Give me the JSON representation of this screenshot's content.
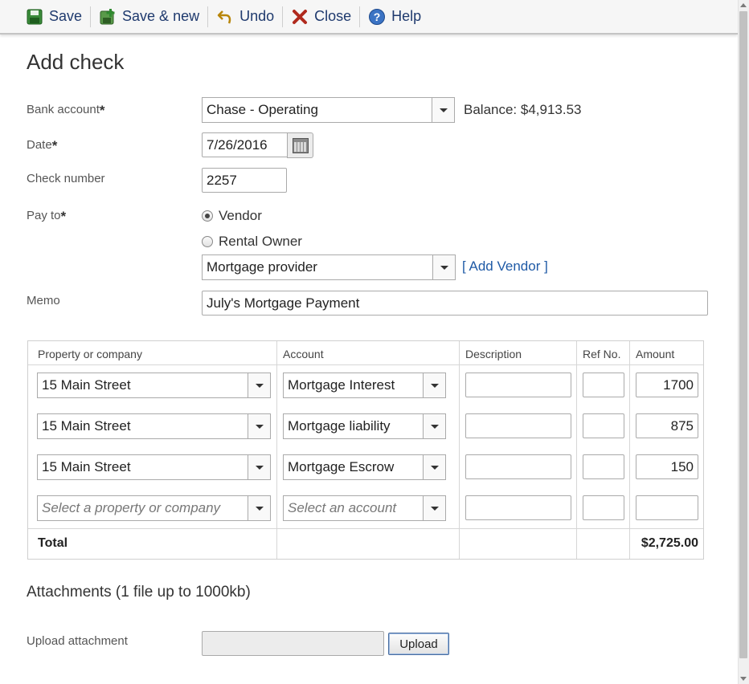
{
  "toolbar": {
    "save": "Save",
    "save_new": "Save & new",
    "undo": "Undo",
    "close": "Close",
    "help": "Help"
  },
  "page_title": "Add check",
  "form": {
    "bank_account_label": "Bank account",
    "bank_account_value": "Chase - Operating",
    "balance": "Balance: $4,913.53",
    "date_label": "Date",
    "date_value": "7/26/2016",
    "check_number_label": "Check number",
    "check_number_value": "2257",
    "pay_to_label": "Pay to",
    "pay_to_options": [
      "Vendor",
      "Rental Owner"
    ],
    "pay_to_selected": "Vendor",
    "payee_value": "Mortgage provider",
    "add_vendor_link": "[ Add Vendor ]",
    "memo_label": "Memo",
    "memo_value": "July's Mortgage Payment",
    "required_mark": "*"
  },
  "grid": {
    "headers": [
      "Property or company",
      "Account",
      "Description",
      "Ref No.",
      "Amount"
    ],
    "rows": [
      {
        "property": "15 Main Street",
        "account": "Mortgage Interest",
        "description": "",
        "ref": "",
        "amount": "1700"
      },
      {
        "property": "15 Main Street",
        "account": "Mortgage liability",
        "description": "",
        "ref": "",
        "amount": "875"
      },
      {
        "property": "15 Main Street",
        "account": "Mortgage Escrow",
        "description": "",
        "ref": "",
        "amount": "150"
      }
    ],
    "new_row": {
      "property_placeholder": "Select a property or company",
      "account_placeholder": "Select an account"
    },
    "total_label": "Total",
    "total_value": "$2,725.00"
  },
  "attachments": {
    "title": "Attachments (1 file up to 1000kb)",
    "upload_label": "Upload attachment",
    "upload_button": "Upload"
  },
  "colors": {
    "toolbar_text": "#1f3a6e",
    "link": "#1f5aa6",
    "close_x": "#b02a1e"
  }
}
